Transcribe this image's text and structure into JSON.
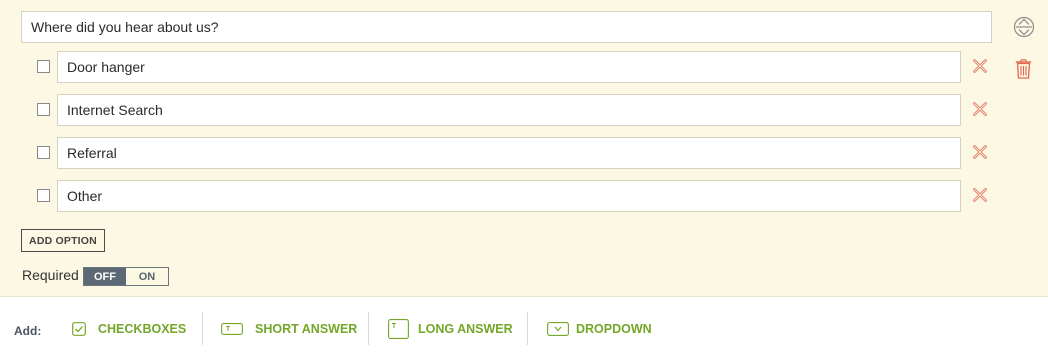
{
  "question": {
    "text": "Where did you hear about us?",
    "reorder_icon": "reorder-icon",
    "delete_icon": "trash-icon"
  },
  "options": [
    {
      "label": "Door hanger",
      "checked": false
    },
    {
      "label": "Internet Search",
      "checked": false
    },
    {
      "label": "Referral",
      "checked": false
    },
    {
      "label": "Other",
      "checked": false
    }
  ],
  "add_option_label": "ADD OPTION",
  "required": {
    "label": "Required",
    "off_label": "OFF",
    "on_label": "ON",
    "value": "OFF"
  },
  "add_bar": {
    "label": "Add:",
    "buttons": [
      {
        "label": "CHECKBOXES",
        "icon": "checkbox-icon"
      },
      {
        "label": "SHORT ANSWER",
        "icon": "short-answer-icon"
      },
      {
        "label": "LONG ANSWER",
        "icon": "long-answer-icon"
      },
      {
        "label": "DROPDOWN",
        "icon": "dropdown-icon"
      }
    ]
  },
  "colors": {
    "editor_background": "#fcf8e4",
    "remove_red": "#e0644d",
    "accent_green": "#74a628",
    "toggle_active": "#5c6975"
  }
}
